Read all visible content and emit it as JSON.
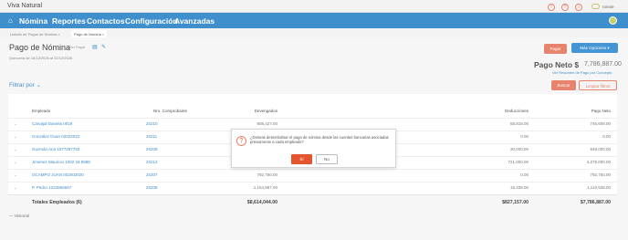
{
  "app": {
    "name": "Viva Natural",
    "user_name": "ronnie"
  },
  "topbar_icons": [
    {
      "name": "bell-icon",
      "glyph": "!"
    },
    {
      "name": "help-icon",
      "glyph": "?"
    },
    {
      "name": "info-icon",
      "glyph": "i"
    }
  ],
  "nav": {
    "home_glyph": "⌂",
    "items": [
      "Nómina",
      "Reportes",
      "Contactos",
      "Configuración",
      "Avanzadas"
    ]
  },
  "tabs": [
    {
      "label": "Listado de Pagos de Nómina",
      "close": "×"
    },
    {
      "label": "Pago de Nómina",
      "close": "×"
    }
  ],
  "page": {
    "title": "Pago de Nómina",
    "subtitle": "Sin Pagar",
    "date_range": "Quincena de 16/12/2026 al 31/12/2026"
  },
  "actions": {
    "pagar": "Pagar",
    "mas_opciones": "Más Opciones ▾"
  },
  "neto": {
    "label": "Pago Neto $",
    "value": "7,786,887.00",
    "note": "Ver Resumen de Pago por Concepto"
  },
  "filter": {
    "label": "Filtrar por",
    "buscar": "Buscar",
    "limpiar": "Limpiar filtros"
  },
  "table": {
    "headers": {
      "empleado": "Empleado",
      "comprobante": "Nro. Comprobante",
      "devengados": "Devengados",
      "deducciones": "Deducciones",
      "neto": "Pago Neto"
    },
    "rows": [
      {
        "empleado": "Carvajal Daniela 0019",
        "comprobante": "20210",
        "devengados": "805,427.00",
        "deducciones": "58,818.00",
        "neto": "746,609.00"
      },
      {
        "empleado": "González Duan 02022022",
        "comprobante": "20211",
        "devengados": "0.00",
        "deducciones": "0.00",
        "neto": "0.00"
      },
      {
        "empleado": "Guzmán Ana 1077287783",
        "comprobante": "20209",
        "devengados": "879,000.00",
        "deducciones": "30,000.00",
        "neto": "849,000.00"
      },
      {
        "empleado": "Jiménez Mauricio 1002 34 8888",
        "comprobante": "20212",
        "devengados": "5,000,000.00",
        "deducciones": "721,000.00",
        "neto": "4,279,000.00"
      },
      {
        "empleado": "OCAMPO JUAN 002002020",
        "comprobante": "20207",
        "devengados": "792,750.00",
        "deducciones": "0.00",
        "neto": "792,750.00"
      },
      {
        "empleado": "P. Pedro 1234566667",
        "comprobante": "20208",
        "devengados": "1,154,867.00",
        "deducciones": "15,339.00",
        "neto": "1,119,528.00"
      }
    ],
    "totals": {
      "label": "Totales Empleados (6)",
      "devengados": "$8,614,044.00",
      "deducciones": "$827,157.00",
      "neto": "$7,786,887.00"
    }
  },
  "historial": "— Historial",
  "modal": {
    "icon": "?",
    "text": "¿Deseas desembolsar el pago de nómina desde las cuentas bancarias asociadas previamente a cada empleado?",
    "yes": "Sí",
    "no": "No"
  },
  "colors": {
    "nav_blue": "#3e8fcc",
    "accent_orange": "#e8836d",
    "confirm_red": "#e2552f"
  }
}
